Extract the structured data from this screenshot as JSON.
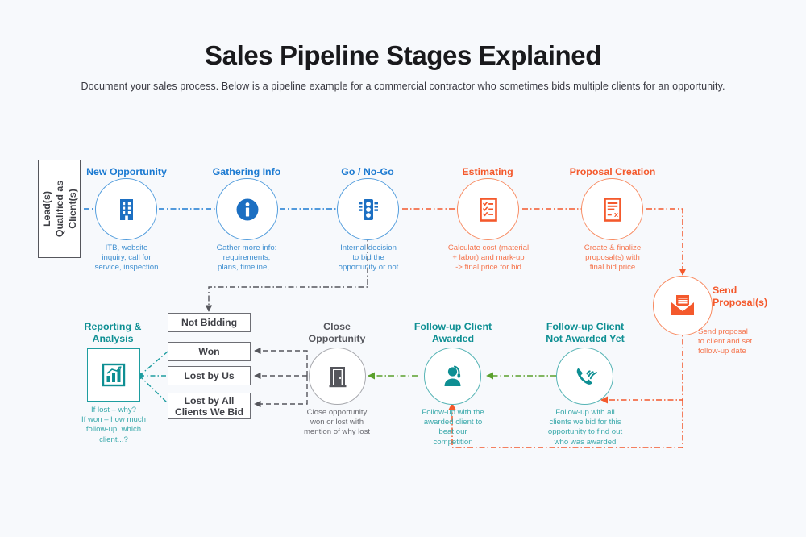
{
  "header": {
    "title": "Sales Pipeline Stages Explained",
    "subtitle": "Document your sales process. Below is a pipeline example for a commercial contractor who sometimes bids multiple clients for an opportunity."
  },
  "colors": {
    "background": "#f7f9fc",
    "blue": "#1c7ad1",
    "orange": "#f4592c",
    "teal": "#0e8f93",
    "grey": "#55565c",
    "green_edge": "#5aa02c"
  },
  "start": {
    "label": "Lead(s)\nQualified as\nClient(s)",
    "line1": "Lead(s) Qualified as Client(s)"
  },
  "stages": [
    {
      "id": "new-opportunity",
      "label": "New Opportunity",
      "caption": "ITB, website inquiry, call for service, inspection",
      "icon": "office-building-icon",
      "color": "blue"
    },
    {
      "id": "gathering-info",
      "label": "Gathering Info",
      "caption": "Gather more info: requirements, plans, timeline,...",
      "icon": "information-icon",
      "color": "blue"
    },
    {
      "id": "go-no-go",
      "label": "Go / No-Go",
      "caption": "Internal decision to bid the opportunity or not",
      "icon": "traffic-light-icon",
      "color": "blue"
    },
    {
      "id": "estimating",
      "label": "Estimating",
      "caption": "Calculate cost (material + labor) and mark-up -> final price for bid",
      "icon": "checklist-icon",
      "color": "orange"
    },
    {
      "id": "proposal-creation",
      "label": "Proposal Creation",
      "caption": "Create & finalize proposal(s) with final bid price",
      "icon": "document-sign-icon",
      "color": "orange"
    },
    {
      "id": "send-proposals",
      "label": "Send Proposal(s)",
      "caption": "Send proposal to client and set follow-up date",
      "icon": "envelope-icon",
      "color": "orange"
    },
    {
      "id": "follow-up-not-awarded",
      "label": "Follow-up Client Not Awarded Yet",
      "caption": "Follow-up with all clients we bid for this opportunity to find out who was awarded",
      "icon": "phone-ringing-icon",
      "color": "teal"
    },
    {
      "id": "follow-up-awarded",
      "label": "Follow-up Client Awarded",
      "caption": "Follow-up with the awarded client to beat our competition",
      "icon": "headset-agent-icon",
      "color": "teal"
    },
    {
      "id": "close-opportunity",
      "label": "Close Opportunity",
      "caption": "Close opportunity won or lost with mention of why lost",
      "icon": "door-icon",
      "color": "grey"
    },
    {
      "id": "reporting-analysis",
      "label": "Reporting & Analysis",
      "caption": "If lost - why? If won - how much follow-up, which client...?",
      "icon": "bar-chart-icon",
      "color": "teal"
    }
  ],
  "stage_labels": {
    "new_opportunity": "New Opportunity",
    "gathering_info": "Gathering Info",
    "go_no_go": "Go / No-Go",
    "estimating": "Estimating",
    "proposal_creation": "Proposal Creation",
    "send_proposals": "Send Proposal(s)",
    "follow_up_not_awarded_l1": "Follow-up Client",
    "follow_up_not_awarded_l2": "Not Awarded Yet",
    "follow_up_awarded_l1": "Follow-up Client",
    "follow_up_awarded_l2": "Awarded",
    "close_opportunity_l1": "Close",
    "close_opportunity_l2": "Opportunity",
    "reporting_l1": "Reporting &",
    "reporting_l2": "Analysis"
  },
  "captions": {
    "new_opportunity": "ITB, website\ninquiry, call for\nservice, inspection",
    "gathering_info": "Gather more info:\nrequirements,\nplans, timeline,...",
    "go_no_go": "Internal decision\nto bid the\nopportunity or not",
    "estimating": "Calculate cost (material\n+ labor) and mark-up\n-> final price for bid",
    "proposal_creation": "Create & finalize\nproposal(s) with\nfinal bid price",
    "send_proposals": "Send proposal\nto client and set\nfollow-up date",
    "follow_up_not_awarded": "Follow-up  with all\nclients we bid for this\nopportunity to find out\nwho was awarded",
    "follow_up_awarded": "Follow-up  with the\nawarded client to\nbeat our\ncompetition",
    "close_opportunity": "Close opportunity\nwon or lost with\nmention of why lost",
    "reporting_analysis": "If lost - why?\nIf won - how much\nfollow-up, which\nclient...?"
  },
  "outcomes": [
    {
      "id": "not-bidding",
      "label": "Not Bidding"
    },
    {
      "id": "won",
      "label": "Won"
    },
    {
      "id": "lost-by-us",
      "label": "Lost by Us"
    },
    {
      "id": "lost-by-all",
      "label": "Lost by All Clients We Bid"
    }
  ],
  "outcome_labels": {
    "not_bidding": "Not Bidding",
    "won": "Won",
    "lost_by_us": "Lost by Us",
    "lost_by_all_l1": "Lost by All",
    "lost_by_all_l2": "Clients We Bid"
  }
}
